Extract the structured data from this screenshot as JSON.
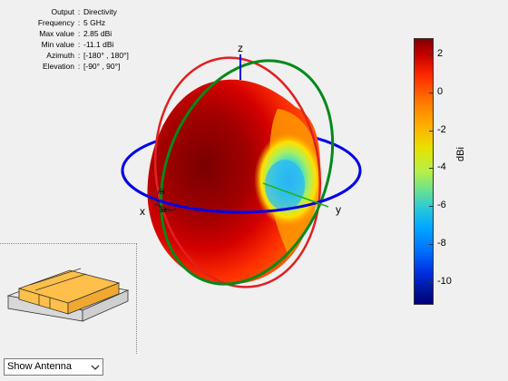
{
  "info": {
    "rows": [
      {
        "label": "Output",
        "value": "Directivity"
      },
      {
        "label": "Frequency",
        "value": "5 GHz"
      },
      {
        "label": "Max value",
        "value": "2.85 dBi"
      },
      {
        "label": "Min value",
        "value": "-11.1 dBi"
      },
      {
        "label": "Azimuth",
        "value": "[-180° , 180°]"
      },
      {
        "label": "Elevation",
        "value": "[-90° , 90°]"
      }
    ]
  },
  "axes": {
    "x": "x",
    "y": "y",
    "z": "z",
    "az_label": "az",
    "el_label": "el"
  },
  "colorbar": {
    "unit": "dBi",
    "ticks": [
      "2",
      "0",
      "-2",
      "-4",
      "-6",
      "-8",
      "-10"
    ],
    "range": [
      -11.1,
      2.85
    ]
  },
  "antenna_select": {
    "value": "Show Antenna"
  },
  "colors": {
    "azimuth_ring": "#0000e6",
    "elevation_ring_red": "#e02020",
    "elevation_ring_green": "#008a1a",
    "antenna_fill": "#ffbf4a"
  }
}
